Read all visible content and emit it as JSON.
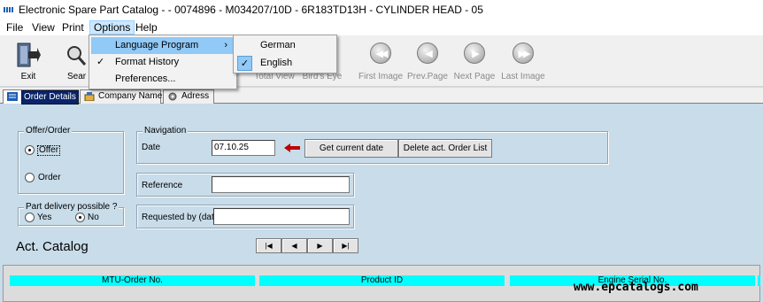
{
  "window": {
    "title": "Electronic Spare Part Catalog -  - 0074896 - M034207/10D - 6R183TD13H - CYLINDER HEAD - 05"
  },
  "menubar": {
    "items": [
      "File",
      "View",
      "Print",
      "Options",
      "Help"
    ],
    "active": "Options"
  },
  "options_menu": {
    "items": [
      {
        "label": "Language Program",
        "checked": false,
        "submenu": true
      },
      {
        "label": "Format History",
        "checked": true,
        "submenu": false
      },
      {
        "label": "Preferences...",
        "checked": false,
        "submenu": false
      }
    ],
    "check_glyph": "✓",
    "submenu_glyph": "›"
  },
  "language_menu": {
    "items": [
      {
        "label": "German",
        "checked": false
      },
      {
        "label": "English",
        "checked": true
      }
    ]
  },
  "toolbar": {
    "exit_label": "Exit",
    "search_label": "Sear",
    "totalview_label": "Total View",
    "birdseye_label": "Bird's Eye",
    "first_label": "First Image",
    "prev_label": "Prev.Page",
    "next_label": "Next Page",
    "last_label": "Last Image"
  },
  "tabs": {
    "order_details": "Order Details",
    "company_name": "Company Name",
    "adress": "Adress"
  },
  "offer_order": {
    "title": "Offer/Order",
    "offer_label": "Offer",
    "order_label": "Order",
    "selected": "Offer"
  },
  "delivery": {
    "title": "Part delivery possible ?",
    "yes_label": "Yes",
    "no_label": "No",
    "selected": "No"
  },
  "navigation": {
    "title": "Navigation",
    "date_label": "Date",
    "date_value": "07.10.25",
    "get_date_button": "Get current date",
    "delete_button": "Delete act. Order List"
  },
  "reference": {
    "label": "Reference",
    "value": ""
  },
  "requested_by": {
    "label": "Requested by (date)",
    "value": ""
  },
  "catalog": {
    "title": "Act. Catalog",
    "nav_first": "|◀",
    "nav_prev": "◀",
    "nav_next": "▶",
    "nav_last": "▶|"
  },
  "grid": {
    "columns": [
      "MTU-Order No.",
      "Product ID",
      "Engine Serial No."
    ]
  },
  "watermark": "www.epcatalogs.com",
  "colors": {
    "background": "#c8dce9",
    "column_header": "#00ffff",
    "menu_highlight": "#91c9f7",
    "arrow": "#c00000"
  }
}
